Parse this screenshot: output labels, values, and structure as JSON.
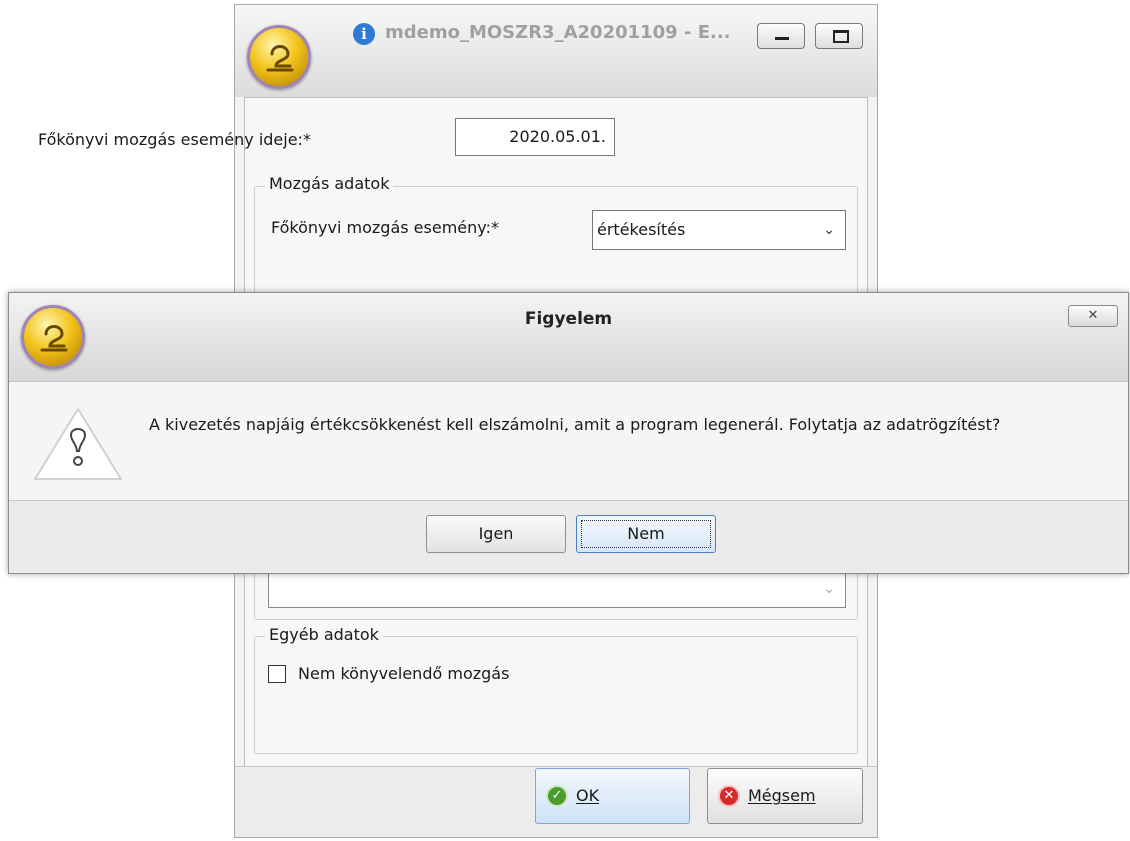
{
  "main_window": {
    "title": "mdemo_MOSZR3_A20201109 - E...",
    "date_label": "Főkönyvi mozgás esemény ideje:*",
    "date_value": "2020.05.01.",
    "movement_group": {
      "legend": "Mozgás adatok",
      "event_label": "Főkönyvi mozgás esemény:*",
      "event_value": "értékesítés"
    },
    "other_group": {
      "legend": "Egyéb adatok",
      "checkbox_label": "Nem könyvelendő mozgás",
      "checkbox_checked": false
    },
    "buttons": {
      "ok": "OK",
      "cancel": "Mégsem"
    }
  },
  "dialog": {
    "title": "Figyelem",
    "message": "A kivezetés napjáig értékcsökkenést kell elszámolni, amit a program legenerál. Folytatja az adatrögzítést?",
    "buttons": {
      "yes": "Igen",
      "no": "Nem"
    }
  },
  "colors": {
    "logo_gold": "#f2c31a",
    "info_blue": "#2e7bd6",
    "ok_green": "#4a9d2c",
    "cancel_red": "#d42b2b"
  }
}
